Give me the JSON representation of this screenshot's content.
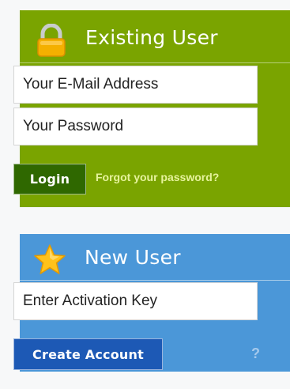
{
  "existing_user": {
    "title": "Existing User",
    "icon": "lock-icon",
    "email_placeholder": "Your E-Mail Address",
    "password_placeholder": "Your Password",
    "login_label": "Login",
    "forgot_label": "Forgot your password?",
    "accent_color": "#7aa400"
  },
  "new_user": {
    "title": "New User",
    "icon": "star-icon",
    "activation_placeholder": "Enter Activation Key",
    "create_label": "Create Account",
    "help_label": "?",
    "accent_color": "#4b97d8"
  }
}
